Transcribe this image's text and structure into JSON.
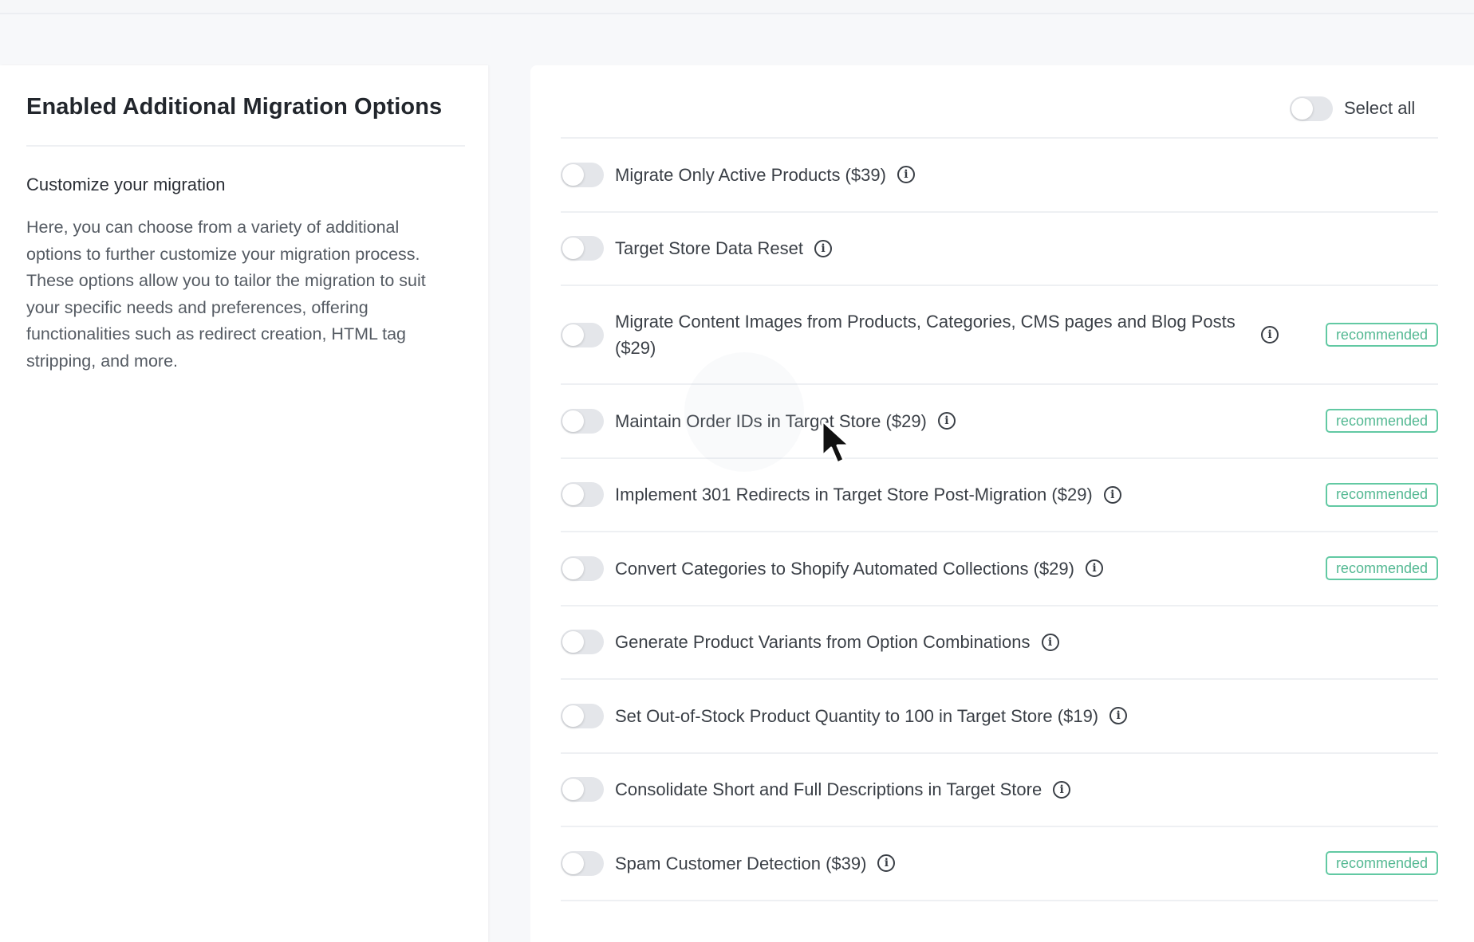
{
  "left": {
    "title": "Enabled Additional Migration Options",
    "subtitle": "Customize your migration",
    "description": "Here, you can choose from a variety of additional options to further customize your migration process. These options allow you to tailor the migration to suit your specific needs and preferences, offering functionalities such as redirect creation, HTML tag stripping, and more."
  },
  "header": {
    "select_all_label": "Select all",
    "select_all_on": false
  },
  "options": [
    {
      "label": "Migrate Only Active Products ($39)",
      "recommended": false,
      "enabled": false
    },
    {
      "label": "Target Store Data Reset",
      "recommended": false,
      "enabled": false
    },
    {
      "label": "Migrate Content Images from Products, Categories, CMS pages and Blog Posts ($29)",
      "recommended": true,
      "enabled": false
    },
    {
      "label": "Maintain Order IDs in Target Store ($29)",
      "recommended": true,
      "enabled": false
    },
    {
      "label": "Implement 301 Redirects in Target Store Post-Migration ($29)",
      "recommended": true,
      "enabled": false
    },
    {
      "label": "Convert Categories to Shopify Automated Collections ($29)",
      "recommended": true,
      "enabled": false
    },
    {
      "label": "Generate Product Variants from Option Combinations",
      "recommended": false,
      "enabled": false
    },
    {
      "label": "Set Out-of-Stock Product Quantity to 100 in Target Store ($19)",
      "recommended": false,
      "enabled": false
    },
    {
      "label": "Consolidate Short and Full Descriptions in Target Store",
      "recommended": false,
      "enabled": false
    },
    {
      "label": "Spam Customer Detection ($39)",
      "recommended": true,
      "enabled": false
    }
  ],
  "badge_label": "recommended",
  "info_glyph": "i",
  "colors": {
    "badge_border": "#62c9a3",
    "badge_text": "#53b892",
    "toggle_off": "#e4e6ea"
  }
}
